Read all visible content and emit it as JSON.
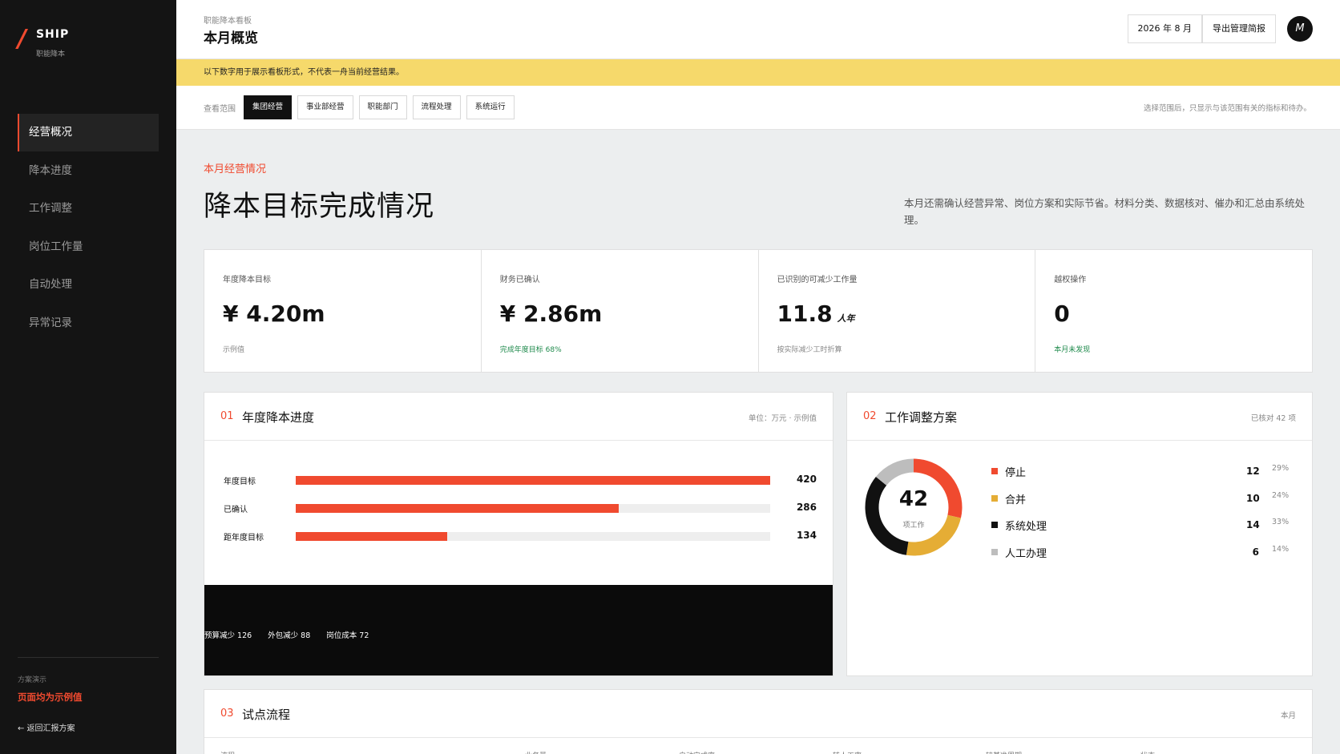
{
  "brand": {
    "name": "SHIP",
    "sub": "职能降本"
  },
  "nav": [
    {
      "label": "经营概况",
      "active": true
    },
    {
      "label": "降本进度"
    },
    {
      "label": "工作调整"
    },
    {
      "label": "岗位工作量"
    },
    {
      "label": "自动处理"
    },
    {
      "label": "异常记录"
    }
  ],
  "sidebar_footer": {
    "caption": "方案演示",
    "note": "页面均为示例值",
    "back": "← 返回汇报方案"
  },
  "header": {
    "breadcrumb": "职能降本看板",
    "title": "本月概览",
    "month_button": "2026 年 8 月",
    "export_button": "导出管理简报",
    "avatar": "M"
  },
  "banner": "以下数字用于展示看板形式，不代表一舟当前经营结果。",
  "scope": {
    "label": "查看范围",
    "tabs": [
      "集团经营",
      "事业部经营",
      "职能部门",
      "流程处理",
      "系统运行"
    ],
    "hint": "选择范围后，只显示与该范围有关的指标和待办。"
  },
  "section": {
    "tag": "本月经营情况",
    "title": "降本目标完成情况",
    "desc": "本月还需确认经营异常、岗位方案和实际节省。材料分类、数据核对、催办和汇总由系统处理。"
  },
  "kpis": [
    {
      "label": "年度降本目标",
      "value": "¥ 4.20m",
      "unit": "",
      "note": "示例值",
      "note_green": false
    },
    {
      "label": "财务已确认",
      "value": "¥ 2.86m",
      "unit": "",
      "note": "完成年度目标 68%",
      "note_green": true
    },
    {
      "label": "已识别的可减少工作量",
      "value": "11.8",
      "unit": "人年",
      "note": "按实际减少工时折算",
      "note_green": false
    },
    {
      "label": "越权操作",
      "value": "0",
      "unit": "",
      "note": "本月未发现",
      "note_green": true
    }
  ],
  "card1": {
    "num": "01",
    "title": "年度降本进度",
    "meta": "单位：万元 · 示例值",
    "strip": [
      "预算减少 126",
      "外包减少 88",
      "岗位成本 72"
    ]
  },
  "card2": {
    "num": "02",
    "title": "工作调整方案",
    "meta": "已核对 42 项",
    "center_value": "42",
    "center_unit": "项工作"
  },
  "card3": {
    "num": "03",
    "title": "试点流程",
    "meta": "本月",
    "columns": [
      "流程",
      "业务量",
      "自动完成率",
      "转人工率",
      "较基准周期",
      "状态"
    ]
  },
  "chart_data": [
    {
      "type": "bar",
      "orientation": "horizontal",
      "categories": [
        "年度目标",
        "已确认",
        "距年度目标"
      ],
      "values": [
        420,
        286,
        134
      ],
      "xlim": [
        0,
        420
      ],
      "color": "#f04a2f"
    },
    {
      "type": "pie",
      "variant": "donut",
      "labels": [
        "停止",
        "合并",
        "系统处理",
        "人工办理"
      ],
      "values": [
        12,
        10,
        14,
        6
      ],
      "percents": [
        "29%",
        "24%",
        "33%",
        "14%"
      ],
      "colors": [
        "#f04a2f",
        "#e5ad35",
        "#111111",
        "#bdbdbd"
      ]
    }
  ]
}
